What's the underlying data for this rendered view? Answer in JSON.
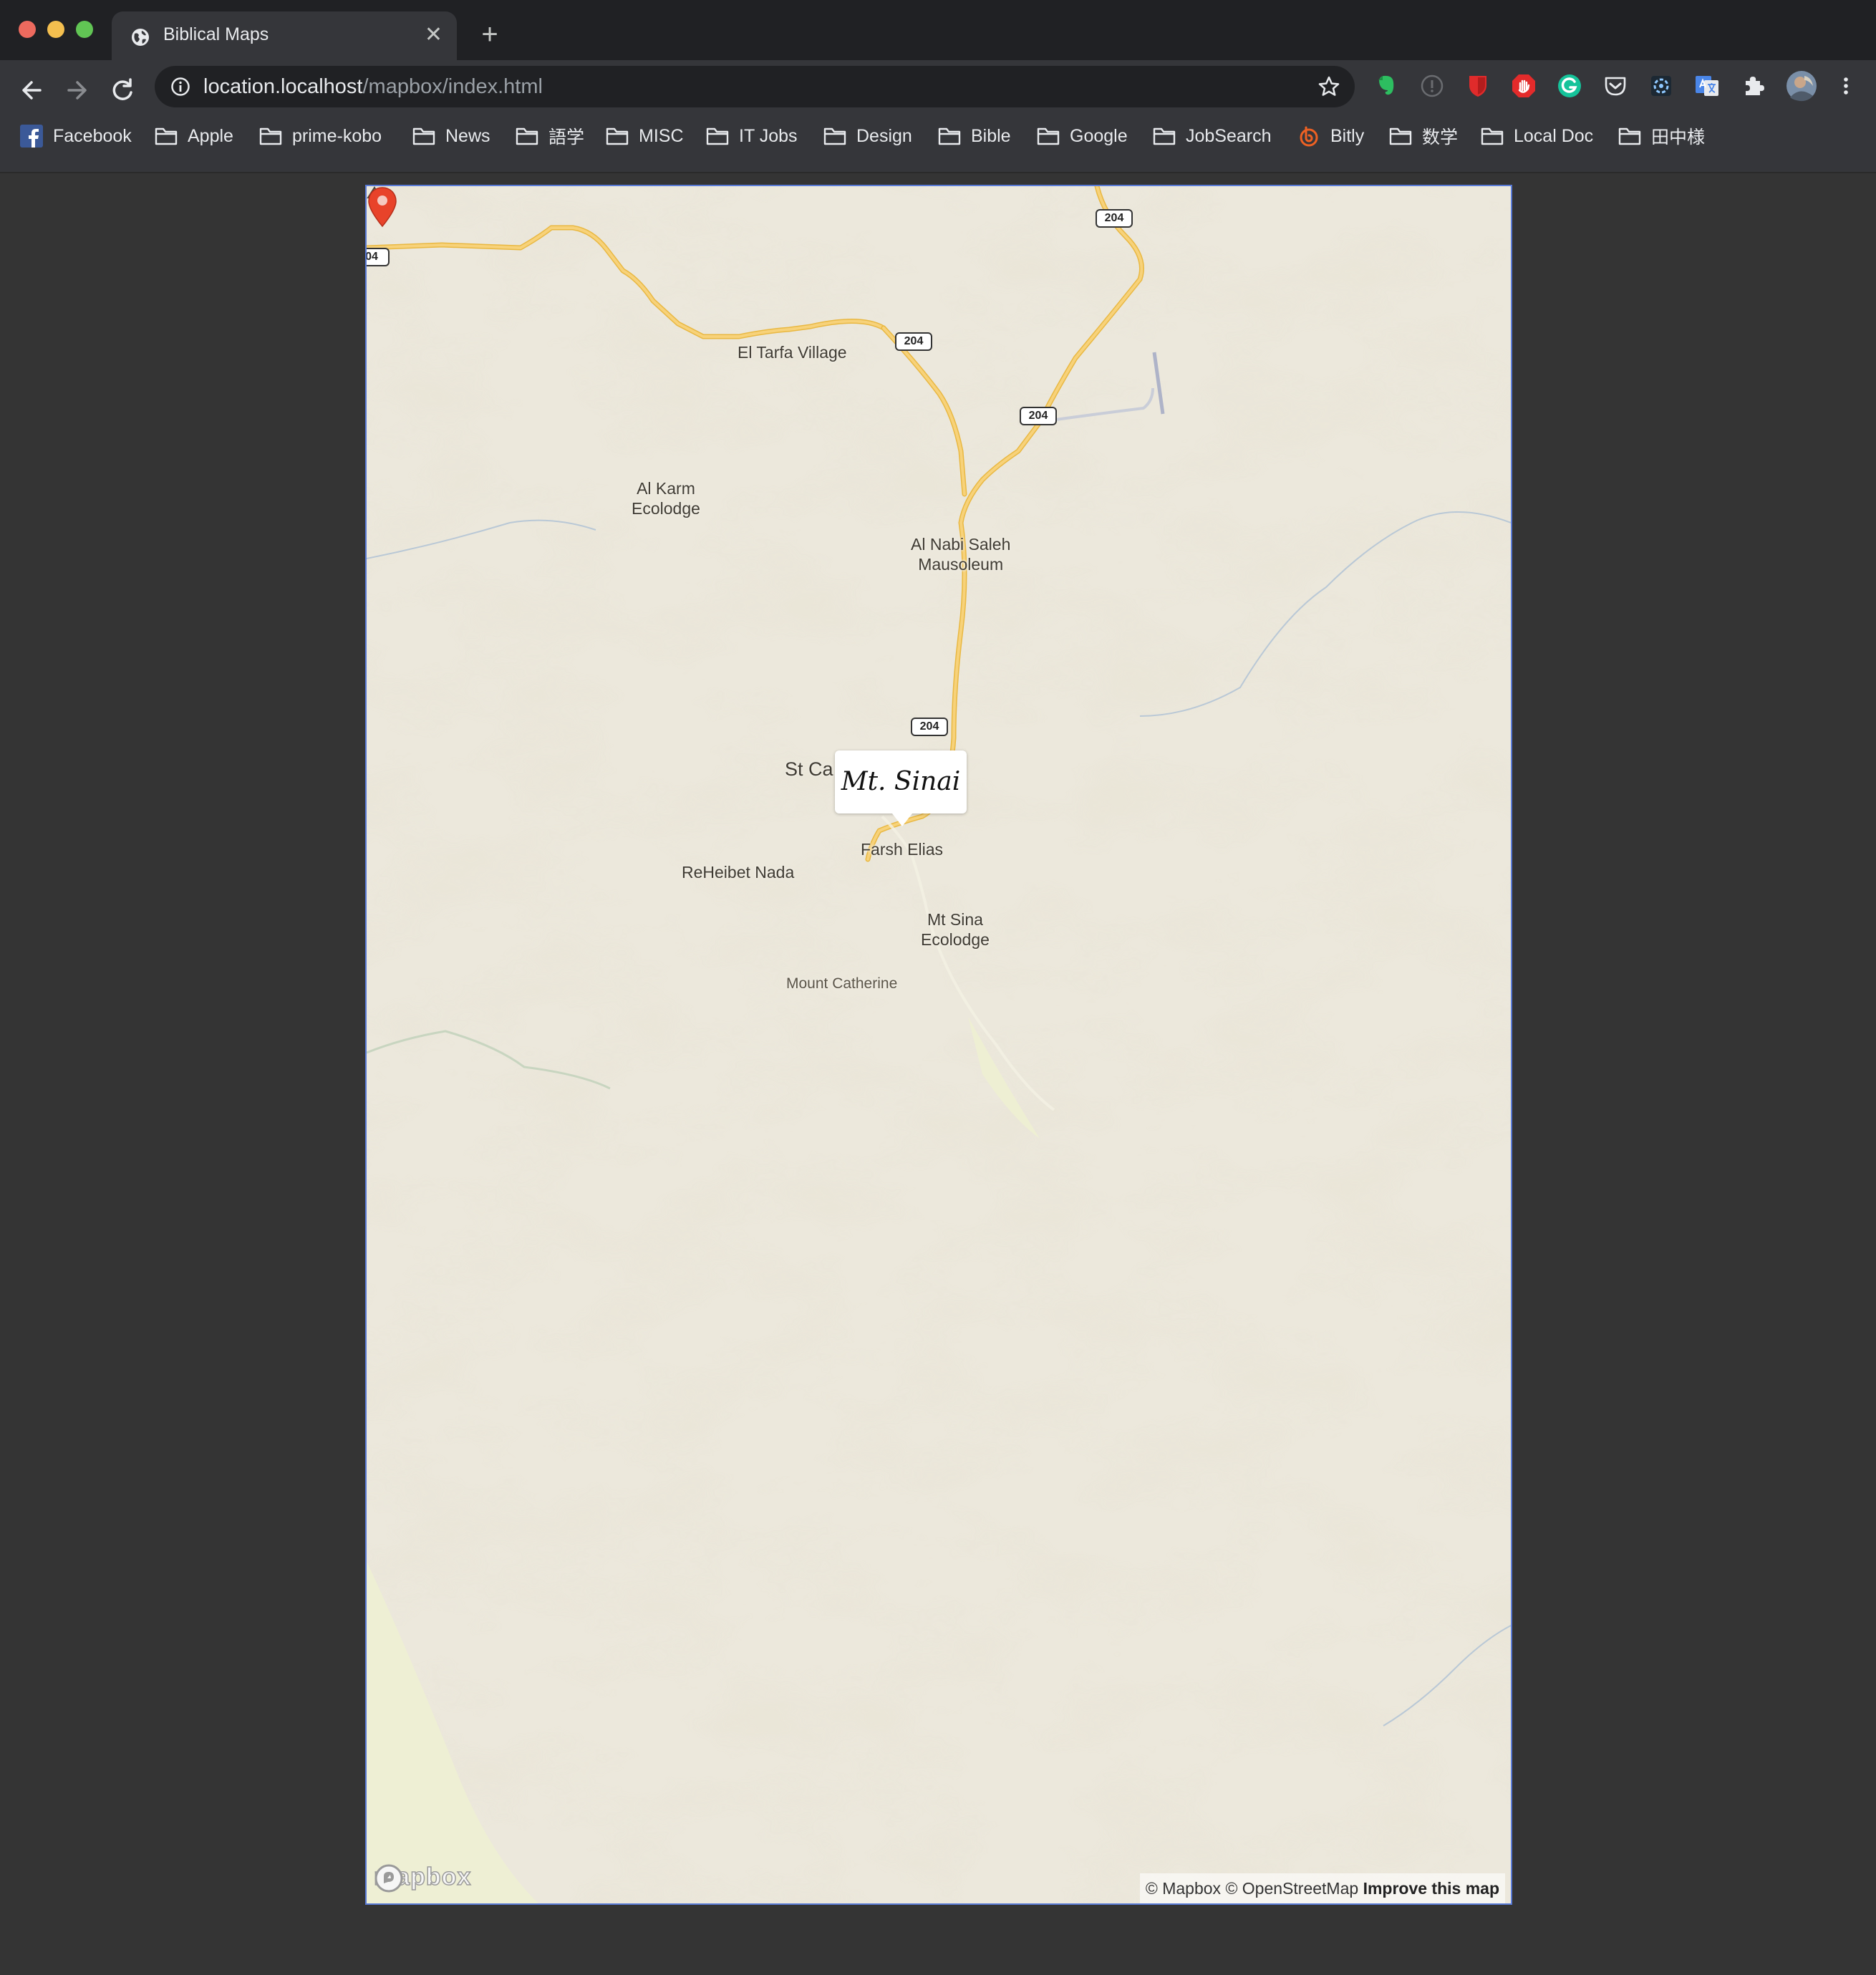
{
  "window": {
    "tab_title": "Biblical Maps",
    "new_tab_symbol": "+",
    "close_symbol": "✕"
  },
  "toolbar": {
    "url_host": "location.localhost",
    "url_path": "/mapbox/index.html"
  },
  "bookmarks": [
    {
      "label": "Facebook",
      "icon": "facebook-icon"
    },
    {
      "label": "Apple",
      "icon": "folder-icon"
    },
    {
      "label": "prime-kobo",
      "icon": "folder-icon"
    },
    {
      "label": "News",
      "icon": "folder-icon"
    },
    {
      "label": "語学",
      "icon": "folder-icon"
    },
    {
      "label": "MISC",
      "icon": "folder-icon"
    },
    {
      "label": "IT Jobs",
      "icon": "folder-icon"
    },
    {
      "label": "Design",
      "icon": "folder-icon"
    },
    {
      "label": "Bible",
      "icon": "folder-icon"
    },
    {
      "label": "Google",
      "icon": "folder-icon"
    },
    {
      "label": "JobSearch",
      "icon": "folder-icon"
    },
    {
      "label": "Bitly",
      "icon": "bitly-icon"
    },
    {
      "label": "数学",
      "icon": "folder-icon"
    },
    {
      "label": "Local Doc",
      "icon": "folder-icon"
    },
    {
      "label": "田中様",
      "icon": "folder-icon"
    }
  ],
  "map": {
    "places": {
      "el_tarfa": "El Tarfa Village",
      "al_karm_1": "Al Karm",
      "al_karm_2": "Ecolodge",
      "al_nabi_1": "Al Nabi Saleh",
      "al_nabi_2": "Mausoleum",
      "st_ca": "St Ca",
      "farsh_elias": "Farsh Elias",
      "reheibet": "ReHeibet Nada",
      "mt_sina_1": "Mt Sina",
      "mt_sina_2": "Ecolodge",
      "mount_catherine": "Mount Catherine"
    },
    "road_shields": [
      "204",
      "204",
      "204",
      "204",
      "04"
    ],
    "popup_title": "Mt. Sinai",
    "logo_text": "mapbox",
    "attribution": {
      "mapbox": "© Mapbox",
      "osm": "© OpenStreetMap",
      "improve": "Improve this map"
    },
    "colors": {
      "land": "#ece8dc",
      "road": "#f2c24f",
      "marker": "#e8432a",
      "water": "#b9c8d6"
    }
  }
}
